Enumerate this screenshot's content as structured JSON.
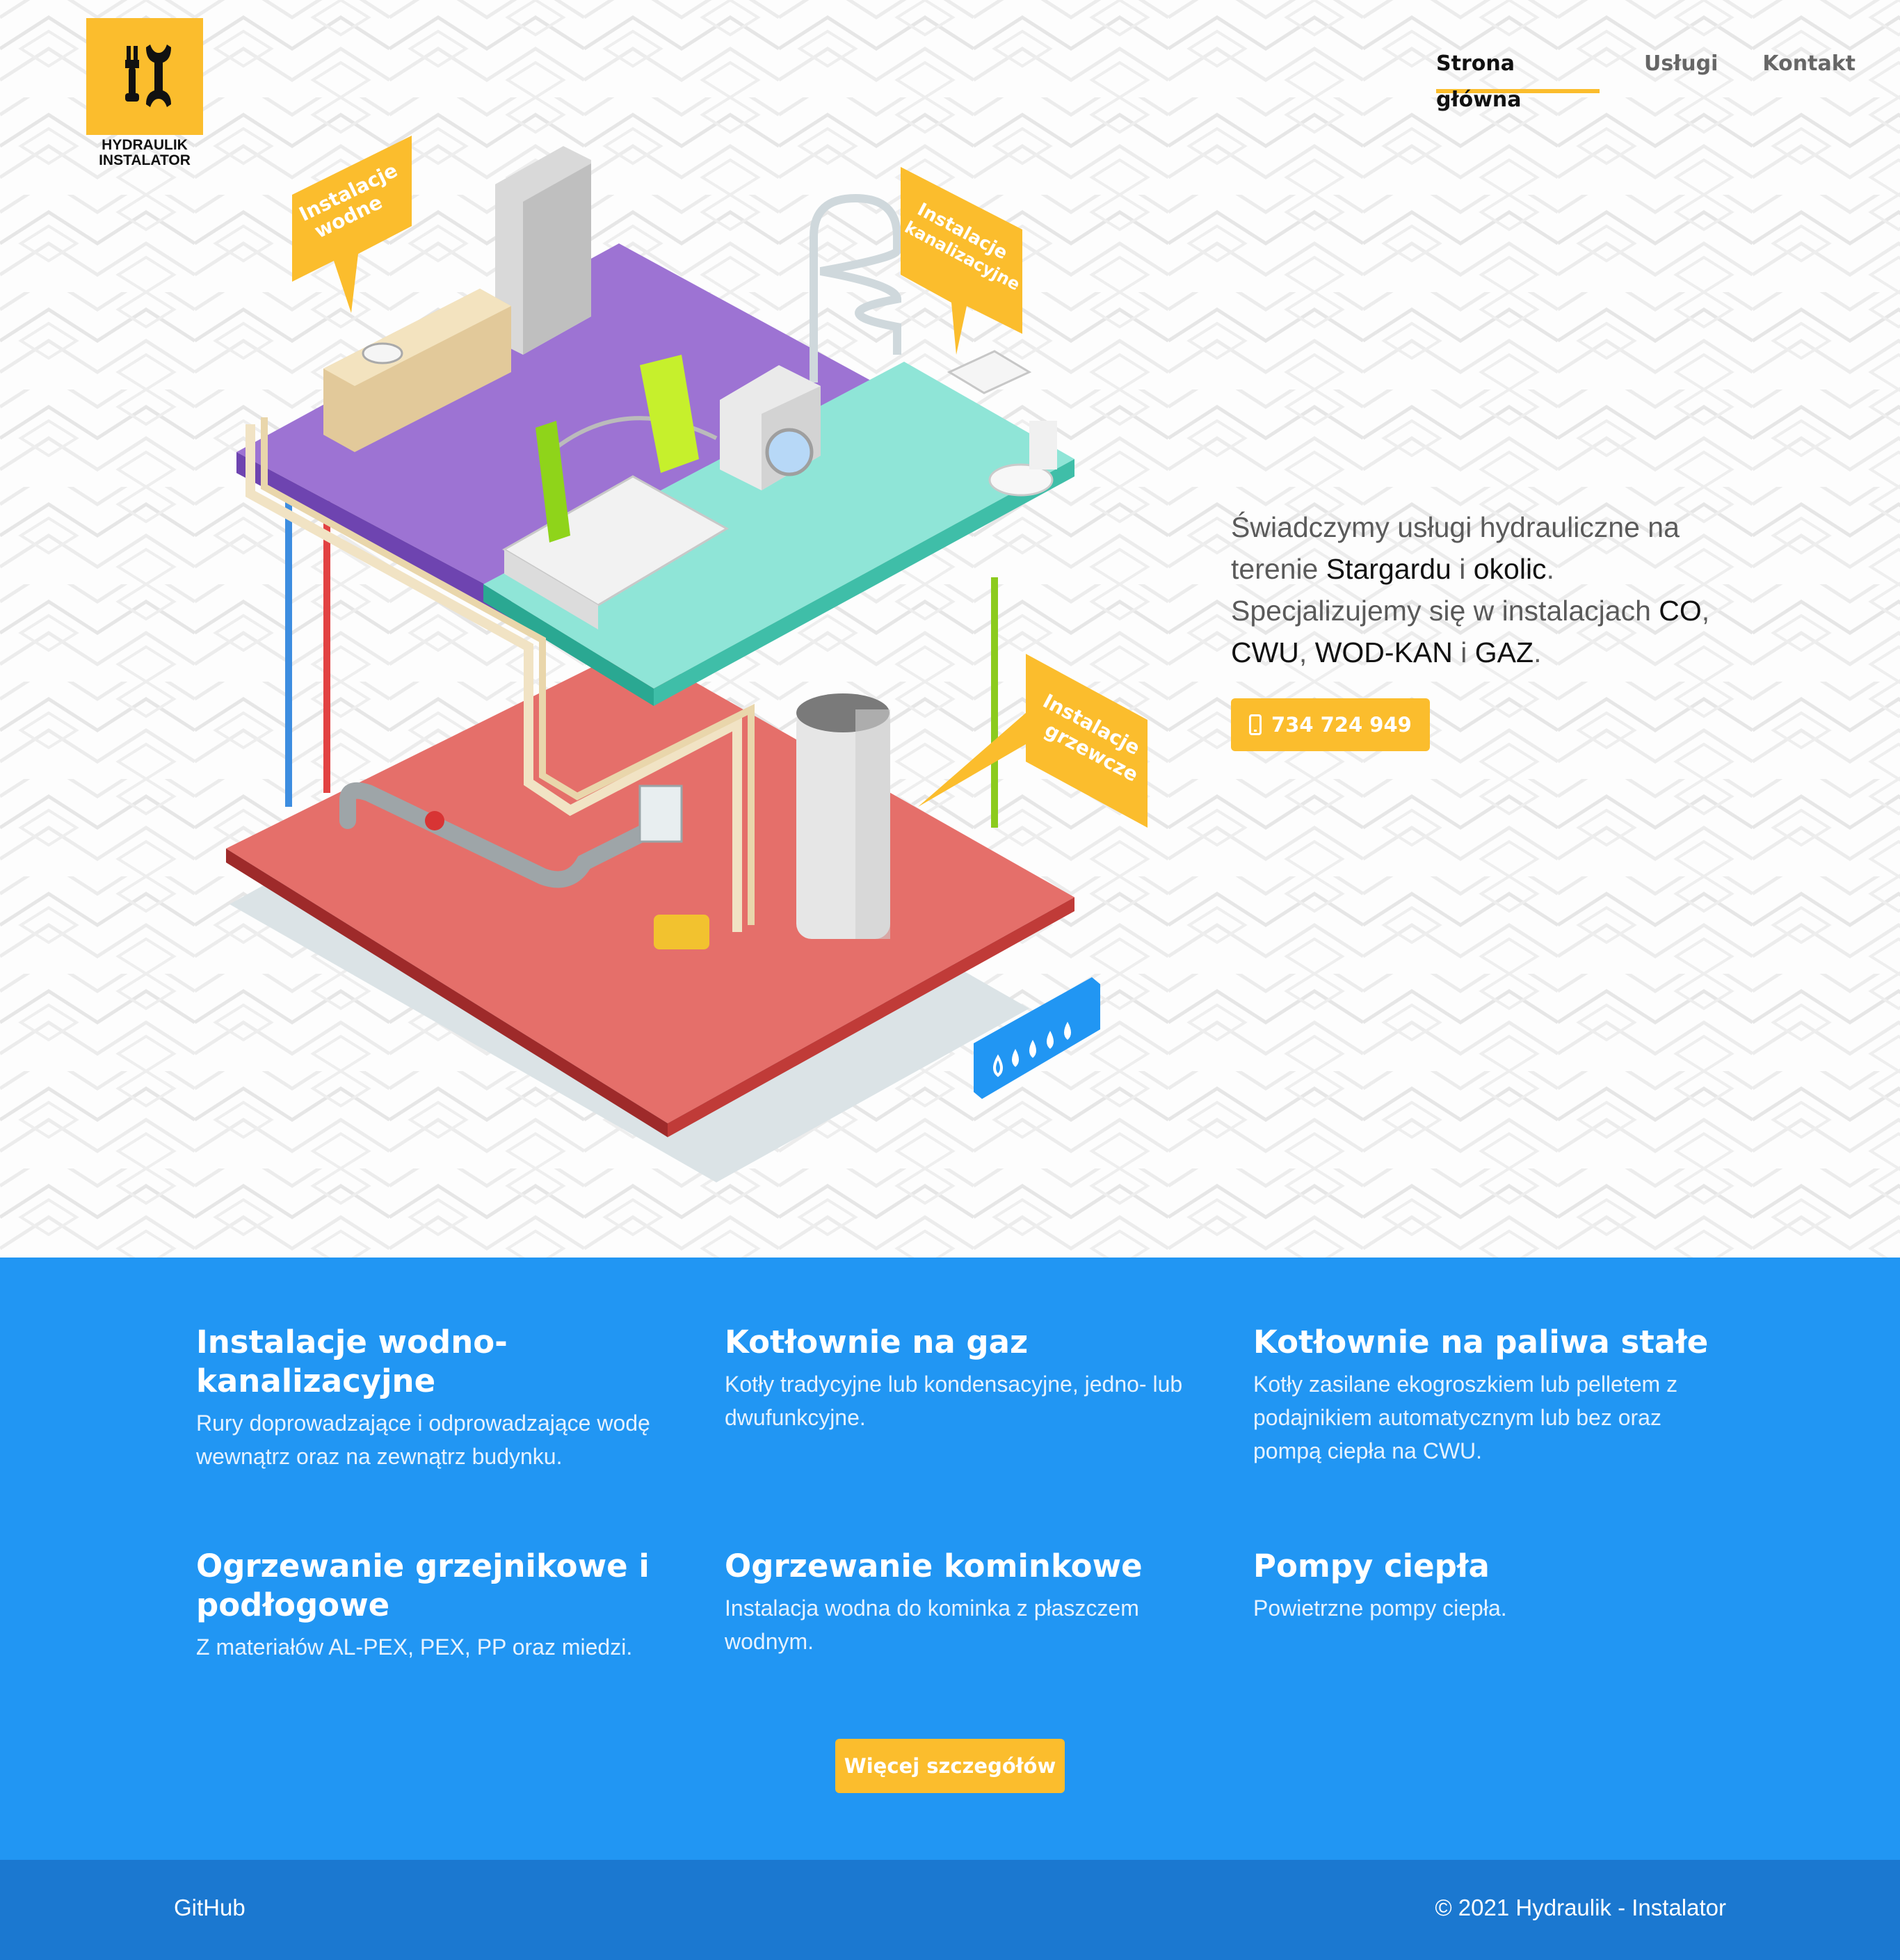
{
  "logo": {
    "line1": "HYDRAULIK",
    "line2": "INSTALATOR"
  },
  "nav": [
    {
      "label": "Strona główna",
      "active": true
    },
    {
      "label": "Usługi",
      "active": false
    },
    {
      "label": "Kontakt",
      "active": false
    }
  ],
  "illustration": {
    "bubble_water_line1": "Instalacje",
    "bubble_water_line2": "wodne",
    "bubble_sewage_line1": "Instalacje",
    "bubble_sewage_line2": "kanalizacyjne",
    "bubble_heating_line1": "Instalacje",
    "bubble_heating_line2": "grzewcze"
  },
  "intro": {
    "t1": "Świadczymy usługi hydrauliczne na terenie ",
    "b1": "Stargardu",
    "t2": " i ",
    "b2": "okolic",
    "t3": ". Specjalizujemy się w instalacjach ",
    "b3": "CO",
    "t4": ", ",
    "b4": "CWU",
    "t5": ", ",
    "b5": "WOD-KAN",
    "t6": " i ",
    "b6": "GAZ",
    "t7": "."
  },
  "phone_button": {
    "label": "734 724 949",
    "icon": "mobile-phone-icon"
  },
  "services": [
    {
      "title": "Instalacje wodno-kanalizacyjne",
      "desc": "Rury doprowadzające i odprowadzające wodę wewnątrz oraz na zewnątrz budynku."
    },
    {
      "title": "Kotłownie na gaz",
      "desc": "Kotły tradycyjne lub kondensacyjne, jedno- lub dwufunkcyjne."
    },
    {
      "title": "Kotłownie na paliwa stałe",
      "desc": "Kotły zasilane ekogroszkiem lub pelletem z podajnikiem automatycznym lub bez oraz pompą ciepła na CWU."
    },
    {
      "title": "Ogrzewanie grzejnikowe i podłogowe",
      "desc": "Z materiałów AL-PEX, PEX, PP oraz miedzi."
    },
    {
      "title": "Ogrzewanie kominkowe",
      "desc": "Instalacja wodna do kominka z płaszczem wodnym."
    },
    {
      "title": "Pompy ciepła",
      "desc": "Powietrzne pompy ciepła."
    }
  ],
  "more_button": "Więcej szczegółów",
  "footer": {
    "github": "GitHub",
    "copyright": "© 2021 Hydraulik - Instalator"
  },
  "colors": {
    "accent": "#fbbd2d",
    "services_bg": "#2196f3",
    "footer_bg": "#1b78d0"
  }
}
